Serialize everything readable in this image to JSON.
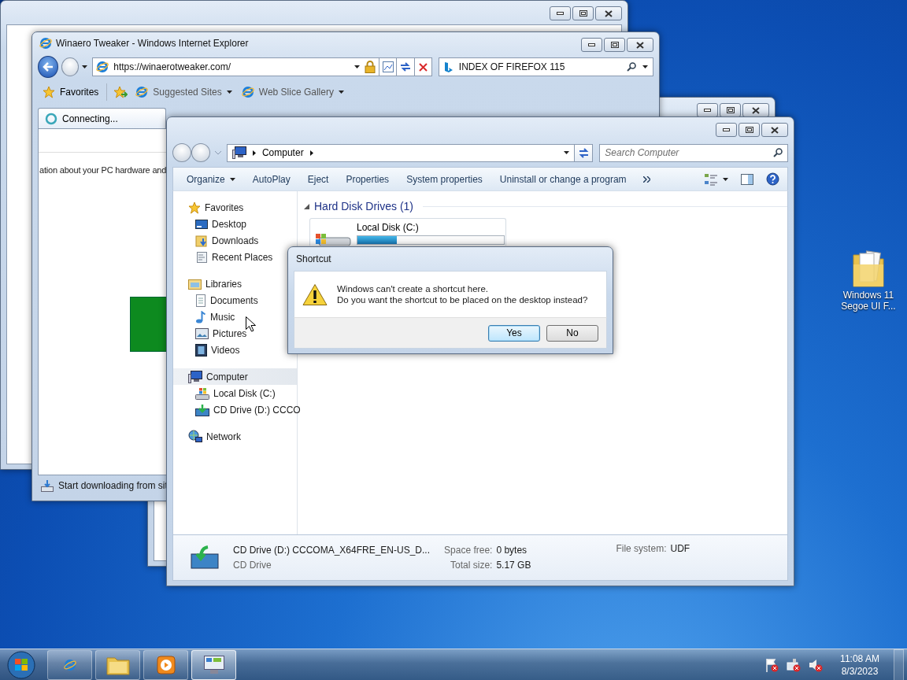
{
  "desktop_icons": [
    {
      "label": "Windows 11 Segoe UI F..."
    }
  ],
  "browser_window": {
    "title": "Winaero Tweaker - Windows Internet Explorer",
    "address": "https://winaerotweaker.com/",
    "search": "INDEX OF FIREFOX 115",
    "favorites_label": "Favorites",
    "favorites_links": [
      "Suggested Sites",
      "Web Slice Gallery"
    ],
    "tabs": [
      {
        "label": "Connecting...",
        "selected": true
      }
    ],
    "page_text": "ation about your PC hardware and",
    "status_text": "Start downloading from sit"
  },
  "explorer_window": {
    "breadcrumb": [
      "Computer"
    ],
    "search_placeholder": "Search Computer",
    "toolbar": [
      {
        "label": "Organize",
        "dropdown": true
      },
      {
        "label": "AutoPlay",
        "dropdown": false
      },
      {
        "label": "Eject",
        "dropdown": false
      },
      {
        "label": "Properties",
        "dropdown": false
      },
      {
        "label": "System properties",
        "dropdown": false
      },
      {
        "label": "Uninstall or change a program",
        "dropdown": false
      }
    ],
    "nav": [
      {
        "label": "Favorites",
        "kind": "star",
        "selected": false,
        "children": [
          {
            "label": "Desktop",
            "kind": "desktop",
            "selected": false
          },
          {
            "label": "Downloads",
            "kind": "downloads",
            "selected": false
          },
          {
            "label": "Recent Places",
            "kind": "recent",
            "selected": false
          }
        ]
      },
      {
        "label": "Libraries",
        "kind": "libraries",
        "selected": false,
        "children": [
          {
            "label": "Documents",
            "kind": "documents",
            "selected": false
          },
          {
            "label": "Music",
            "kind": "music",
            "selected": false
          },
          {
            "label": "Pictures",
            "kind": "pictures",
            "selected": false
          },
          {
            "label": "Videos",
            "kind": "videos",
            "selected": false
          }
        ]
      },
      {
        "label": "Computer",
        "kind": "computer",
        "selected": true,
        "children": [
          {
            "label": "Local Disk (C:)",
            "kind": "disk",
            "selected": false
          },
          {
            "label": "CD Drive (D:) CCCO",
            "kind": "cd",
            "selected": false
          }
        ]
      },
      {
        "label": "Network",
        "kind": "network",
        "selected": false
      }
    ],
    "group": {
      "title": "Hard Disk Drives (1)",
      "expanded": true,
      "drives": [
        {
          "name": "Local Disk (C:)",
          "level": 0.27
        }
      ]
    },
    "details": {
      "name": "CD Drive (D:) CCCOMA_X64FRE_EN-US_D...",
      "type": "CD Drive",
      "fields": [
        {
          "label": "Space free:",
          "value": "0 bytes"
        },
        {
          "label": "Total size:",
          "value": "5.17 GB"
        },
        {
          "label": "File system:",
          "value": "UDF"
        }
      ]
    }
  },
  "dialog": {
    "title": "Shortcut",
    "message_lines": [
      "Windows can't create a shortcut here.",
      "Do you want the shortcut to be placed on the desktop instead?"
    ],
    "buttons": [
      {
        "label": "Yes",
        "default": true
      },
      {
        "label": "No",
        "default": false
      }
    ]
  },
  "taskbar": {
    "buttons": [
      {
        "kind": "browser",
        "selected": false
      },
      {
        "kind": "folder",
        "selected": false
      },
      {
        "kind": "media",
        "selected": false
      },
      {
        "kind": "control-panel",
        "selected": true
      }
    ],
    "clock": {
      "time": "11:08 AM",
      "date": "8/3/2023"
    }
  }
}
